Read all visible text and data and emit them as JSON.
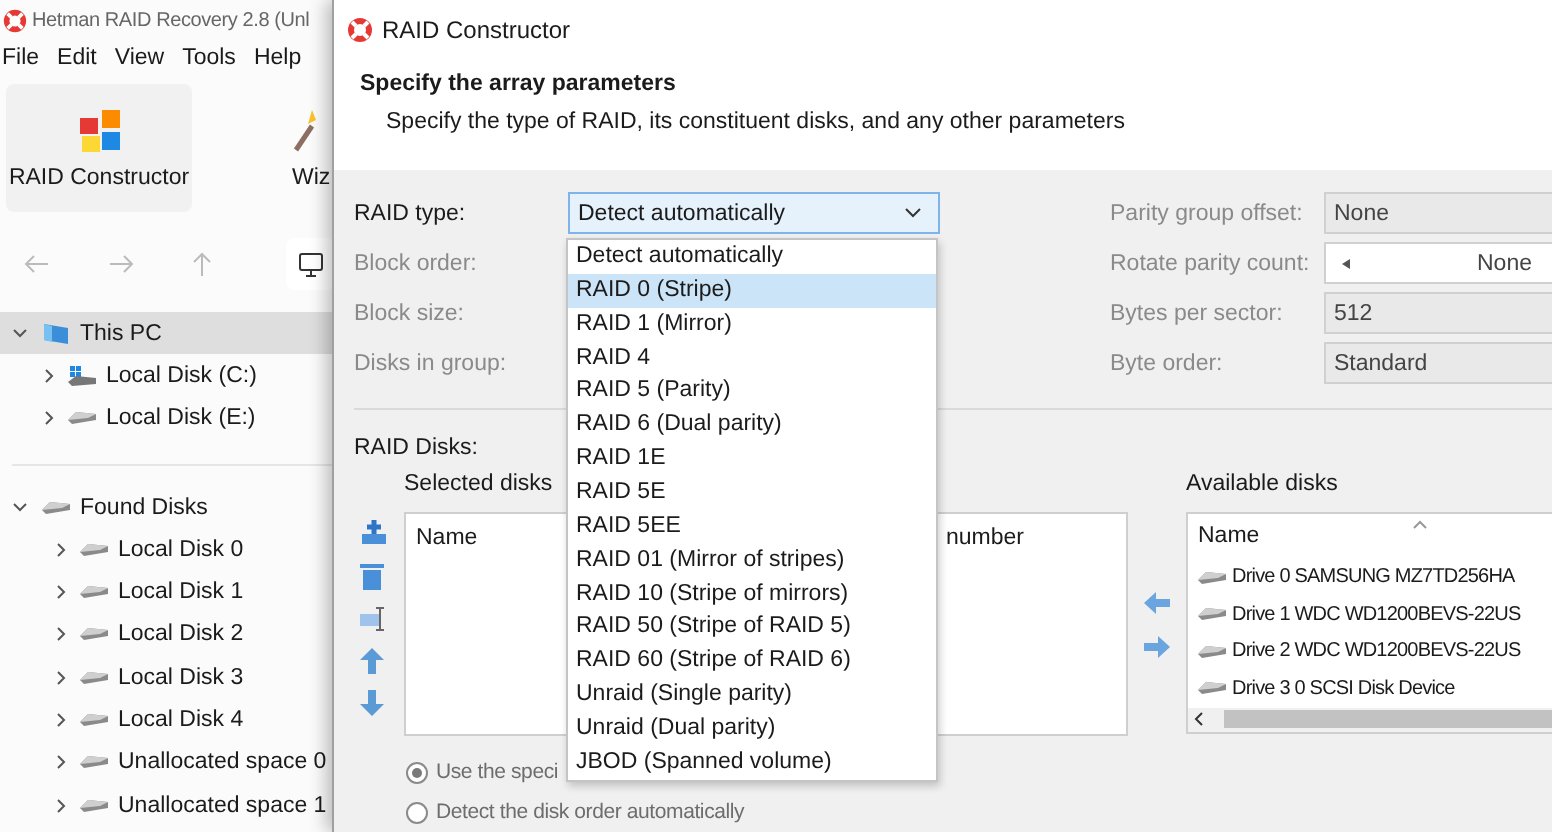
{
  "app": {
    "title": "Hetman RAID Recovery 2.8 (Unl",
    "menu": [
      "File",
      "Edit",
      "View",
      "Tools",
      "Help"
    ],
    "toolbar": [
      {
        "label": "RAID Constructor",
        "kind": "puzzle"
      },
      {
        "label": "Wiz",
        "kind": "wand"
      }
    ],
    "tree": [
      {
        "label": "This PC",
        "kind": "computer",
        "expanded": true,
        "selected": true,
        "children": [
          {
            "label": "Local Disk (C:)",
            "kind": "system_disk",
            "expanded": false,
            "selected": false
          },
          {
            "label": "Local Disk (E:)",
            "kind": "disk",
            "expanded": false,
            "selected": false
          }
        ]
      },
      {
        "label": "Found Disks",
        "kind": "disk",
        "expanded": true,
        "selected": false,
        "children": [
          {
            "label": "Local Disk 0",
            "kind": "disk",
            "expanded": false,
            "selected": false
          },
          {
            "label": "Local Disk 1",
            "kind": "disk",
            "expanded": false,
            "selected": false
          },
          {
            "label": "Local Disk 2",
            "kind": "disk",
            "expanded": false,
            "selected": false
          },
          {
            "label": "Local Disk 3",
            "kind": "disk",
            "expanded": false,
            "selected": false
          },
          {
            "label": "Local Disk 4",
            "kind": "disk",
            "expanded": false,
            "selected": false
          },
          {
            "label": "Unallocated space 0",
            "kind": "disk",
            "expanded": false,
            "selected": false
          },
          {
            "label": "Unallocated space 1",
            "kind": "disk",
            "expanded": false,
            "selected": false
          }
        ]
      }
    ]
  },
  "dialog": {
    "title": "RAID Constructor",
    "heading": "Specify the array parameters",
    "description": "Specify the type of RAID, its constituent disks, and any other parameters",
    "left_params": [
      {
        "label": "RAID type:",
        "kind": "combo",
        "disabled": false,
        "value": "Detect automatically"
      },
      {
        "label": "Block order:",
        "kind": "label",
        "disabled": true
      },
      {
        "label": "Block size:",
        "kind": "label",
        "disabled": true
      },
      {
        "label": "Disks in group:",
        "kind": "label",
        "disabled": true
      }
    ],
    "right_params": [
      {
        "label": "Parity group offset:",
        "kind": "field",
        "disabled": true,
        "value": "None"
      },
      {
        "label": "Rotate parity count:",
        "kind": "spin",
        "disabled": true,
        "value": "None"
      },
      {
        "label": "Bytes per sector:",
        "kind": "field",
        "disabled": true,
        "value": "512"
      },
      {
        "label": "Byte order:",
        "kind": "field",
        "disabled": true,
        "value": "Standard"
      }
    ],
    "raid_disks_label": "RAID Disks:",
    "selected_disks": {
      "label": "Selected disks",
      "columns": [
        "Name",
        "number"
      ]
    },
    "available_disks": {
      "label": "Available disks",
      "columns": [
        "Name"
      ],
      "rows": [
        "Drive 0 SAMSUNG MZ7TD256HA",
        "Drive 1 WDC WD1200BEVS-22US",
        "Drive 2 WDC WD1200BEVS-22US",
        "Drive 3 0 SCSI Disk Device"
      ]
    },
    "disk_order_options": [
      {
        "label": "Use the speci",
        "selected": true
      },
      {
        "label": "Detect the disk order automatically",
        "selected": false
      }
    ],
    "raid_type_dropdown": [
      {
        "label": "Detect automatically",
        "selected": false
      },
      {
        "label": "RAID 0 (Stripe)",
        "selected": true
      },
      {
        "label": "RAID 1 (Mirror)",
        "selected": false
      },
      {
        "label": "RAID 4",
        "selected": false
      },
      {
        "label": "RAID 5 (Parity)",
        "selected": false
      },
      {
        "label": "RAID 6 (Dual parity)",
        "selected": false
      },
      {
        "label": "RAID 1E",
        "selected": false
      },
      {
        "label": "RAID 5E",
        "selected": false
      },
      {
        "label": "RAID 5EE",
        "selected": false
      },
      {
        "label": "RAID 01 (Mirror of stripes)",
        "selected": false
      },
      {
        "label": "RAID 10 (Stripe of mirrors)",
        "selected": false
      },
      {
        "label": "RAID 50 (Stripe of RAID 5)",
        "selected": false
      },
      {
        "label": "RAID 60 (Stripe of RAID 6)",
        "selected": false
      },
      {
        "label": "Unraid (Single parity)",
        "selected": false
      },
      {
        "label": "Unraid (Dual parity)",
        "selected": false
      },
      {
        "label": "JBOD (Spanned volume)",
        "selected": false
      }
    ]
  }
}
